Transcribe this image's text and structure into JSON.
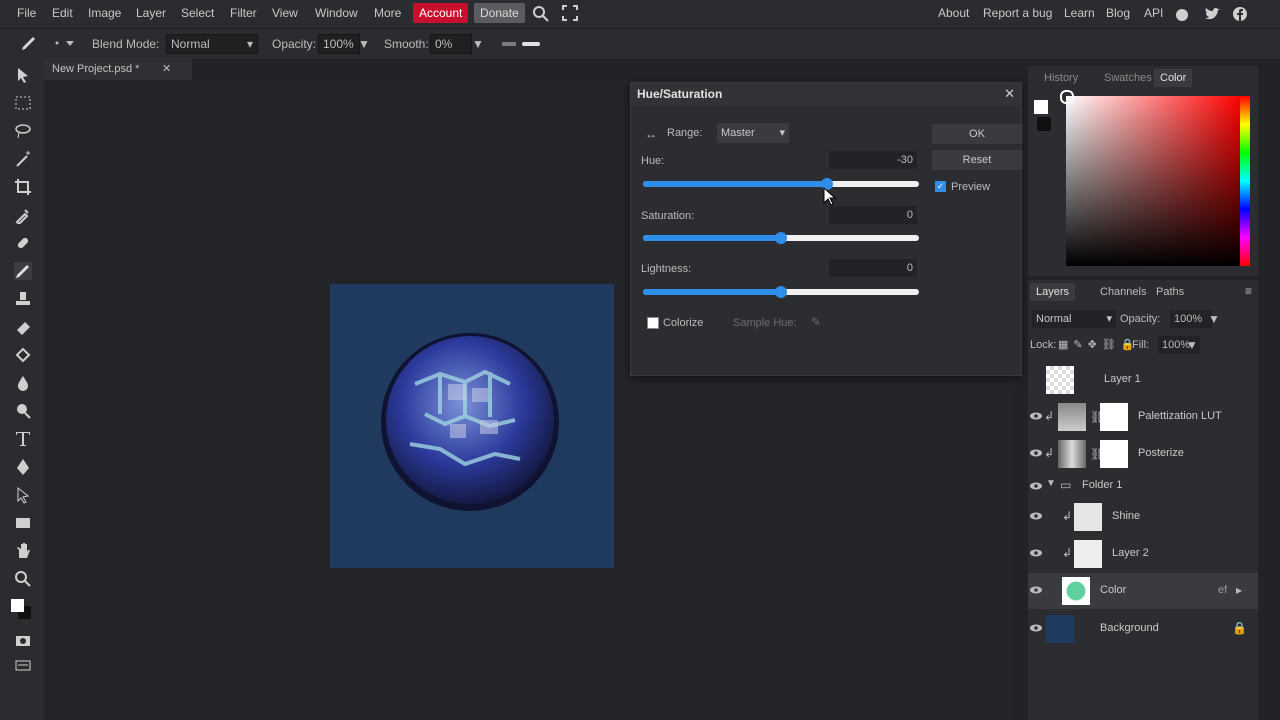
{
  "menubar": {
    "items": [
      "File",
      "Edit",
      "Image",
      "Layer",
      "Select",
      "Filter",
      "View",
      "Window",
      "More"
    ],
    "account": "Account",
    "donate": "Donate",
    "right_links": [
      "About",
      "Report a bug",
      "Learn",
      "Blog",
      "API"
    ]
  },
  "options": {
    "blend_mode_label": "Blend Mode:",
    "blend_mode_value": "Normal",
    "opacity_label": "Opacity:",
    "opacity_value": "100%",
    "smooth_label": "Smooth:",
    "smooth_value": "0%"
  },
  "document": {
    "tab_title": "New Project.psd *"
  },
  "dialog": {
    "title": "Hue/Saturation",
    "range_label": "Range:",
    "range_value": "Master",
    "hue_label": "Hue:",
    "hue_value": "-30",
    "saturation_label": "Saturation:",
    "saturation_value": "0",
    "lightness_label": "Lightness:",
    "lightness_value": "0",
    "colorize_label": "Colorize",
    "sample_hue_label": "Sample Hue:",
    "ok": "OK",
    "reset": "Reset",
    "preview_label": "Preview",
    "preview_checked": true
  },
  "color_panel": {
    "tabs": [
      "History",
      "Swatches",
      "Color"
    ],
    "active_tab": "Color"
  },
  "layers_panel": {
    "tabs": [
      "Layers",
      "Channels",
      "Paths"
    ],
    "blend_value": "Normal",
    "opacity_label": "Opacity:",
    "opacity_value": "100%",
    "lock_label": "Lock:",
    "fill_label": "Fill:",
    "fill_value": "100%",
    "layers": [
      {
        "name": "Layer 1"
      },
      {
        "name": "Palettization LUT"
      },
      {
        "name": "Posterize"
      },
      {
        "name": "Folder 1"
      },
      {
        "name": "Shine"
      },
      {
        "name": "Layer 2"
      },
      {
        "name": "Color"
      },
      {
        "name": "Background"
      }
    ],
    "color_layer_fx": "ef"
  },
  "colors": {
    "accent": "#2f8eea",
    "account_bg": "#c8102e",
    "artboard": "#1f3a5e"
  }
}
